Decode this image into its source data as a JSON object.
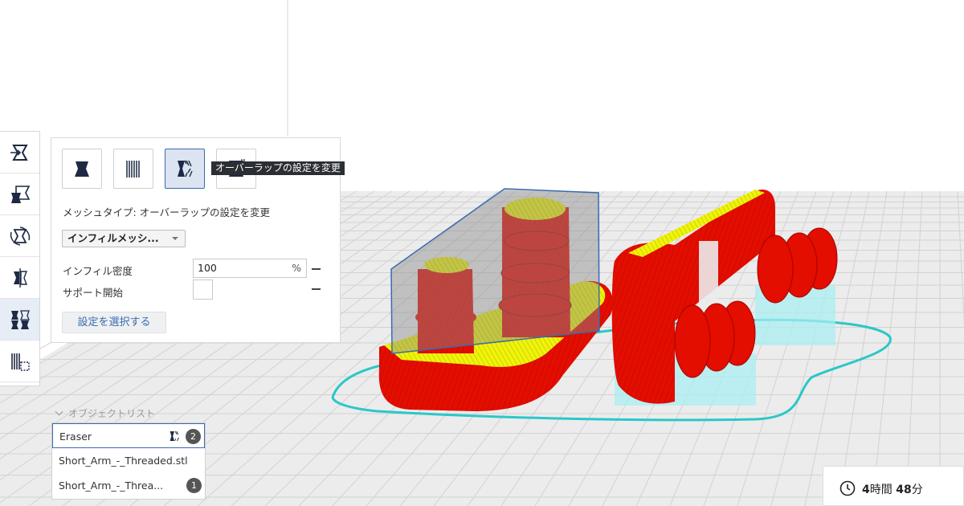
{
  "toolbar": {
    "tools": [
      {
        "name": "move-tool",
        "icon": "move-icon"
      },
      {
        "name": "scale-tool",
        "icon": "scale-icon"
      },
      {
        "name": "rotate-tool",
        "icon": "rotate-icon"
      },
      {
        "name": "mirror-tool",
        "icon": "mirror-icon"
      },
      {
        "name": "per-model-settings-tool",
        "icon": "per-model-settings-icon",
        "active": true
      },
      {
        "name": "support-blocker-tool",
        "icon": "support-blocker-icon"
      }
    ]
  },
  "panel": {
    "mesh_buttons": [
      {
        "icon": "normal-model-icon"
      },
      {
        "icon": "print-as-support-icon"
      },
      {
        "icon": "modify-overlap-icon",
        "active": true
      },
      {
        "icon": "support-mesh-icon"
      }
    ],
    "tooltip": "オーバーラップの設定を変更",
    "mesh_type_label": "メッシュタイプ: オーバーラップの設定を変更",
    "dropdown_value": "インフィルメッシ...",
    "infill_density_label": "インフィル密度",
    "infill_density_value": "100",
    "infill_density_unit": "%",
    "support_start_label": "サポート開始",
    "select_settings_button": "設定を選択する"
  },
  "object_list": {
    "header": "オブジェクトリスト",
    "items": [
      {
        "name": "Eraser",
        "badge": "2",
        "selected": true
      },
      {
        "name": "Short_Arm_-_Threaded.stl",
        "badge": ""
      },
      {
        "name": "Short_Arm_-_Threa...",
        "badge": "1"
      }
    ]
  },
  "print_time": {
    "hours": "4",
    "hours_unit": "時間",
    "minutes": "48",
    "minutes_unit": "分"
  },
  "colors": {
    "accent": "#3a6bb0",
    "model_red": "#e30d00",
    "model_yellow": "#f2f20a",
    "support_cyan": "#7fe6ea",
    "build_plate": "#ececec",
    "grid": "#cfcfcf"
  }
}
